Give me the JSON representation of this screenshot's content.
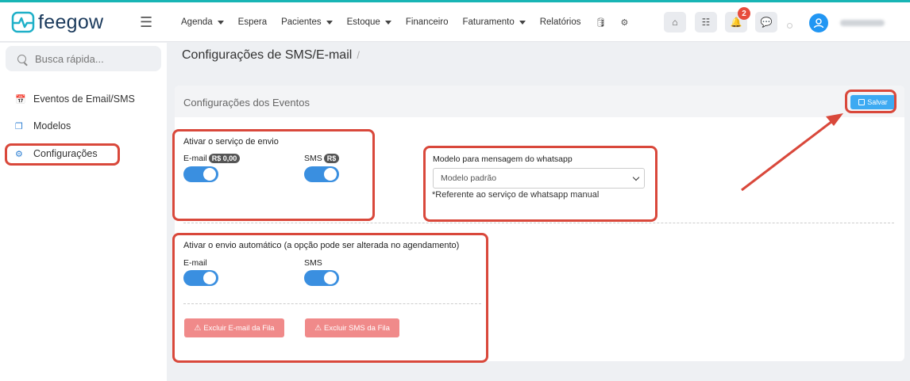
{
  "brand": {
    "name": "feegow"
  },
  "nav": {
    "items": [
      {
        "label": "Agenda",
        "caret": true
      },
      {
        "label": "Espera",
        "caret": false
      },
      {
        "label": "Pacientes",
        "caret": true
      },
      {
        "label": "Estoque",
        "caret": true
      },
      {
        "label": "Financeiro",
        "caret": false
      },
      {
        "label": "Faturamento",
        "caret": true
      },
      {
        "label": "Relatórios",
        "caret": false
      }
    ],
    "notification_count": "2"
  },
  "sidebar": {
    "search_placeholder": "Busca rápida...",
    "items": [
      {
        "label": "Eventos de Email/SMS",
        "icon": "calendar-icon"
      },
      {
        "label": "Modelos",
        "icon": "copy-icon"
      },
      {
        "label": "Configurações",
        "icon": "gears-icon"
      }
    ]
  },
  "page": {
    "title": "Configurações de SMS/E-mail",
    "breadcrumb_sep": "/"
  },
  "panel": {
    "title": "Configurações dos Eventos",
    "save_label": "Salvar",
    "service": {
      "heading": "Ativar o serviço de envio",
      "email_label": "E-mail",
      "email_price": "R$ 0,00",
      "sms_label": "SMS",
      "sms_price": "R$",
      "email_on": true,
      "sms_on": true
    },
    "whatsapp": {
      "label": "Modelo para mensagem do whatsapp",
      "selected": "Modelo padrão",
      "note": "*Referente ao serviço de whatsapp manual"
    },
    "auto": {
      "heading": "Ativar o envio automático (a opção pode ser alterada no agendamento)",
      "email_label": "E-mail",
      "sms_label": "SMS",
      "email_on": true,
      "sms_on": true,
      "clear_email_label": "Excluir E-mail da Fila",
      "clear_sms_label": "Excluir SMS da Fila"
    }
  },
  "colors": {
    "primary": "#3a8fe0",
    "save": "#3daaf2",
    "danger": "#f08a8a",
    "annotation": "#d9483b"
  }
}
